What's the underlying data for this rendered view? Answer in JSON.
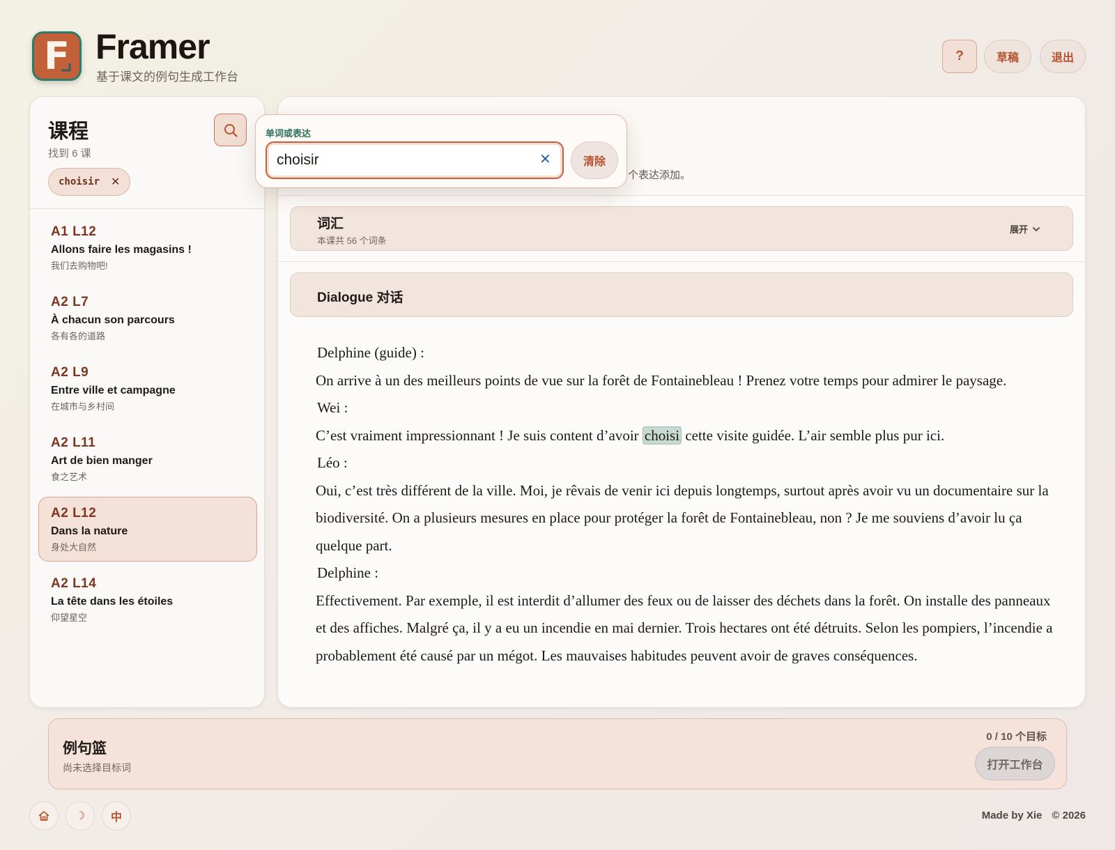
{
  "header": {
    "logo_letter": "F",
    "title": "Framer",
    "subtitle": "基于课文的例句生成工作台",
    "help_label": "?",
    "draft_label": "草稿",
    "logout_label": "退出"
  },
  "sidebar": {
    "title": "课程",
    "count_text": "找到 6 课",
    "filter_chip": "choisir",
    "lessons": [
      {
        "code": "A1 L12",
        "name": "Allons faire les magasins !",
        "cn": "我们去购物吧!",
        "active": false
      },
      {
        "code": "A2 L7",
        "name": "À chacun son parcours",
        "cn": "各有各的道路",
        "active": false
      },
      {
        "code": "A2 L9",
        "name": "Entre ville et campagne",
        "cn": "在城市与乡村间",
        "active": false
      },
      {
        "code": "A2 L11",
        "name": "Art de bien manger",
        "cn": "食之艺术",
        "active": false
      },
      {
        "code": "A2 L12",
        "name": "Dans la nature",
        "cn": "身处大自然",
        "active": true
      },
      {
        "code": "A2 L14",
        "name": "La tête dans les étoiles",
        "cn": "仰望星空",
        "active": false
      }
    ]
  },
  "search_popover": {
    "label": "单词或表达",
    "value": "choisir",
    "clear_label": "清除"
  },
  "main": {
    "hint_fragment": "个表达添加。",
    "vocab": {
      "title": "词汇",
      "subtitle": "本课共 56 个词条",
      "expand_label": "展开"
    },
    "dialogue": {
      "title": "Dialogue 对话",
      "lines": {
        "s1": "Delphine (guide) :",
        "l1": "On arrive à un des meilleurs points de vue sur la forêt de Fontainebleau ! Prenez votre temps pour admirer le paysage.",
        "s2": "Wei :",
        "l2_pre": "C’est vraiment impressionnant ! Je suis content d’avoir ",
        "l2_hl": "choisi",
        "l2_post": " cette visite guidée. L’air semble plus pur ici.",
        "s3": "Léo :",
        "l3": "Oui, c’est très différent de la ville. Moi, je rêvais de venir ici depuis longtemps, surtout après avoir vu un documentaire sur la biodiversité. On a plusieurs mesures en place pour protéger la forêt de Fontainebleau, non ? Je me souviens d’avoir lu ça quelque part.",
        "s4": "Delphine :",
        "l4": "Effectivement. Par exemple, il est interdit d’allumer des feux ou de laisser des déchets dans la forêt. On installe des panneaux et des affiches. Malgré ça, il y a eu un incendie en mai dernier. Trois hectares ont été détruits. Selon les pompiers, l’incendie a probablement été causé par un mégot. Les mauvaises habitudes peuvent avoir de graves conséquences."
      }
    }
  },
  "basket": {
    "title": "例句篮",
    "subtitle": "尚未选择目标词",
    "count": "0 / 10 个目标",
    "open_label": "打开工作台"
  },
  "footer": {
    "home_icon": "home-icon",
    "theme_icon": "moon-icon",
    "lang_label": "中",
    "credit": "Made by Xie",
    "year": "© 2026"
  },
  "colors": {
    "accent": "#c2603a",
    "teal": "#2f7a6a",
    "highlight": "#c7d9d0"
  }
}
